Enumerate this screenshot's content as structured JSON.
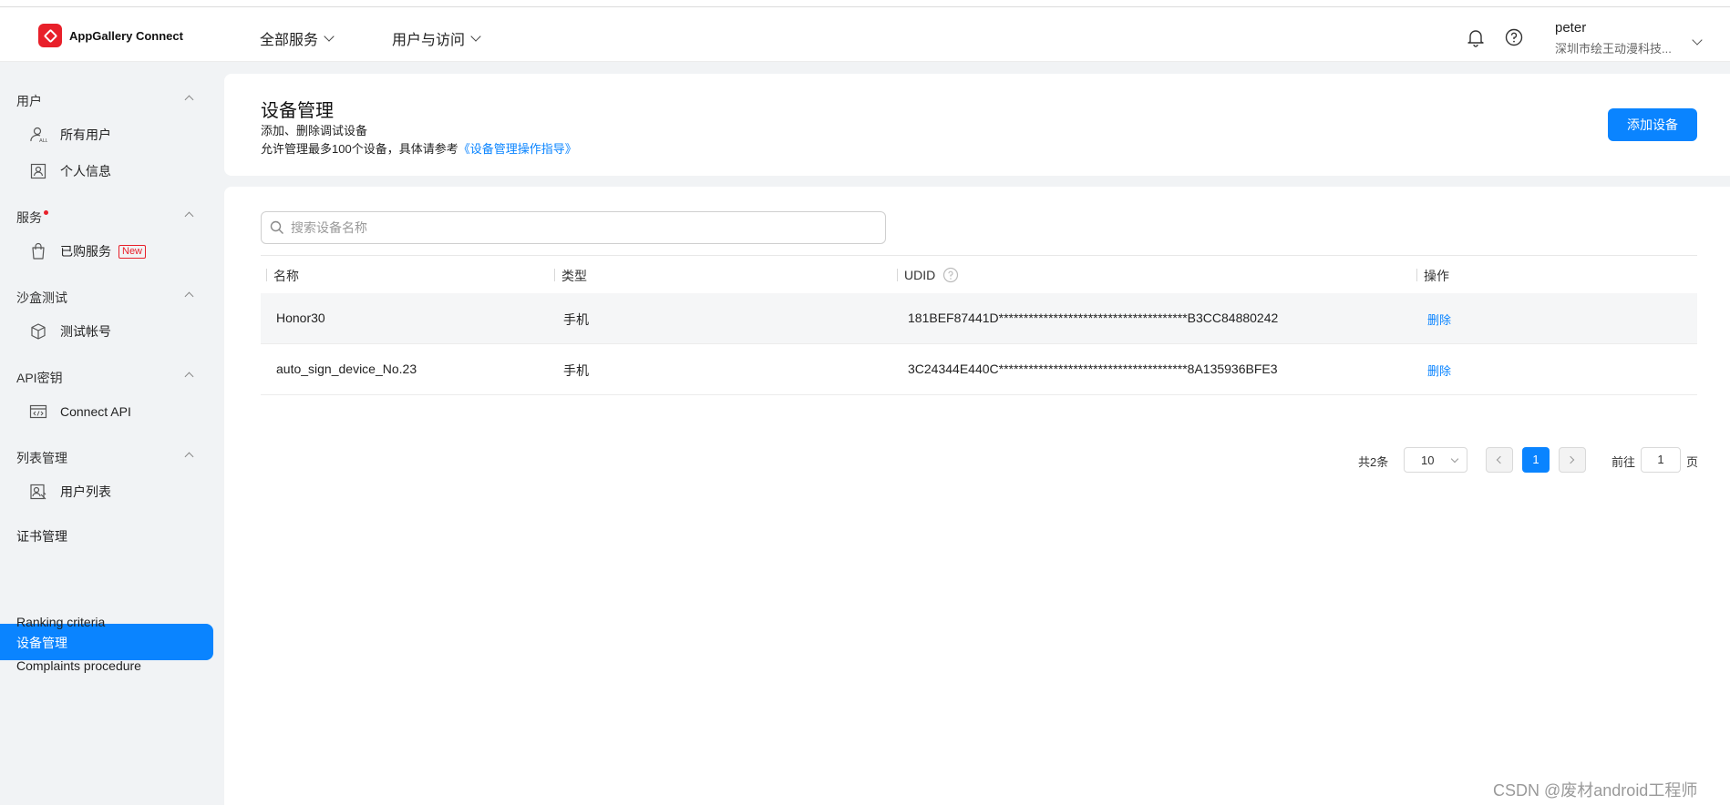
{
  "header": {
    "app_name": "AppGallery Connect",
    "nav": [
      "全部服务",
      "用户与访问"
    ],
    "user_name": "peter",
    "user_org": "深圳市绘王动漫科技..."
  },
  "sidebar": {
    "groups": [
      {
        "label": "用户",
        "items": [
          {
            "label": "所有用户",
            "icon": "all-users-icon"
          },
          {
            "label": "个人信息",
            "icon": "profile-icon"
          }
        ]
      },
      {
        "label": "服务",
        "items": [
          {
            "label": "已购服务",
            "icon": "bag-icon",
            "badge": "New"
          }
        ]
      },
      {
        "label": "沙盒测试",
        "items": [
          {
            "label": "测试帐号",
            "icon": "cube-icon"
          }
        ]
      },
      {
        "label": "API密钥",
        "items": [
          {
            "label": "Connect API",
            "icon": "code-window-icon"
          }
        ]
      },
      {
        "label": "列表管理",
        "items": [
          {
            "label": "用户列表",
            "icon": "user-list-icon"
          }
        ]
      }
    ],
    "top_items": [
      "证书管理",
      "设备管理",
      "Ranking criteria",
      "Complaints procedure"
    ],
    "active": "设备管理"
  },
  "page": {
    "title": "设备管理",
    "desc1": "添加、删除调试设备",
    "desc2_prefix": "允许管理最多100个设备，具体请参考",
    "desc2_link": "《设备管理操作指导》",
    "add_button": "添加设备"
  },
  "search": {
    "placeholder": "搜索设备名称"
  },
  "table": {
    "columns": [
      "名称",
      "类型",
      "UDID",
      "操作"
    ],
    "rows": [
      {
        "name": "Honor30",
        "type": "手机",
        "udid": "181BEF87441D**************************************B3CC84880242",
        "op": "删除"
      },
      {
        "name": "auto_sign_device_No.23",
        "type": "手机",
        "udid": "3C24344E440C**************************************8A135936BFE3",
        "op": "删除"
      }
    ]
  },
  "pagination": {
    "total": "共2条",
    "page_size": "10",
    "current": "1",
    "goto_prefix": "前往",
    "goto_value": "1",
    "goto_suffix": "页"
  },
  "watermark": "CSDN @废材android工程师",
  "colors": {
    "accent": "#0a84ff",
    "brand_red": "#e8202a"
  }
}
